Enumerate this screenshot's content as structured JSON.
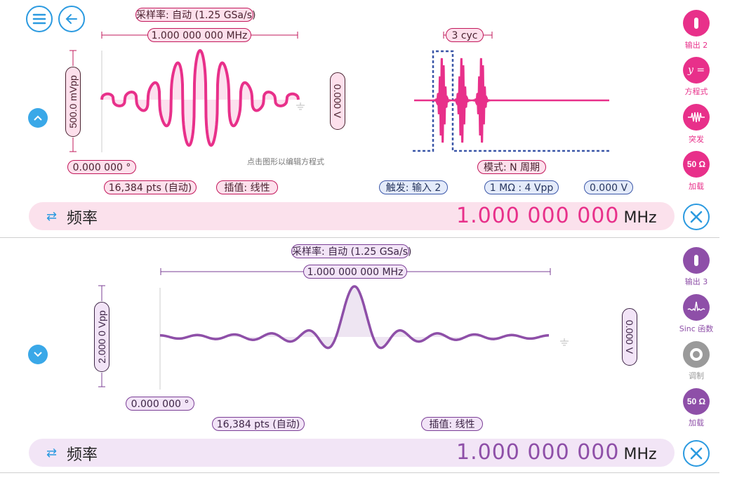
{
  "colors": {
    "ch1": "#e8308a",
    "ch2": "#8e4fa8",
    "accent": "#2b9ae0",
    "gray": "#9a9a9a"
  },
  "ch1": {
    "sample_rate": "采样率: 自动 (1.25 GSa/s)",
    "freq_span": "1.000 000 000 MHz",
    "amplitude": "500.0 mVpp",
    "offset": "0.000 V",
    "phase": "0.000 000 °",
    "points": "16,384 pts (自动)",
    "interp": "插值: 线性",
    "edit_hint": "点击图形以编辑方程式",
    "burst_cycles": "3 cyc",
    "burst_mode": "模式: N 周期",
    "trigger": "触发: 输入 2",
    "impedance": "1 MΩ : 4 Vpp",
    "trigger_level": "0.000 V",
    "bar_label": "频率",
    "bar_value": "1.000 000 000",
    "bar_unit": "MHz",
    "side": [
      {
        "icon": "output-icon",
        "label": "输出 2"
      },
      {
        "icon": "equation-icon",
        "glyph": "y =",
        "label": "方程式"
      },
      {
        "icon": "burst-icon",
        "label": "突发"
      },
      {
        "icon": "load-icon",
        "glyph": "50 Ω",
        "label": "加载"
      }
    ]
  },
  "ch2": {
    "sample_rate": "采样率: 自动 (1.25 GSa/s)",
    "freq_span": "1.000 000 000 MHz",
    "amplitude": "2.000 0 Vpp",
    "offset": "0.000 V",
    "phase": "0.000 000 °",
    "points": "16,384 pts (自动)",
    "interp": "插值: 线性",
    "bar_label": "频率",
    "bar_value": "1.000 000 000",
    "bar_unit": "MHz",
    "side": [
      {
        "icon": "output-icon",
        "label": "输出 3"
      },
      {
        "icon": "sinc-icon",
        "label": "Sinc 函数"
      },
      {
        "icon": "modulation-icon",
        "label": "调制"
      },
      {
        "icon": "load-icon",
        "glyph": "50 Ω",
        "label": "加载"
      }
    ]
  }
}
